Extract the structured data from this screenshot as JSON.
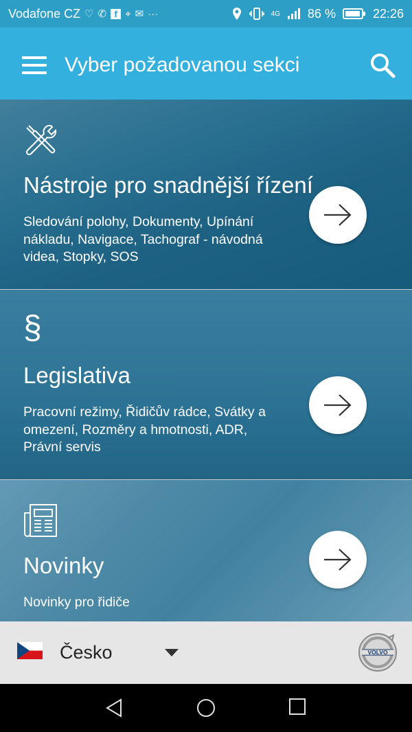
{
  "status_bar": {
    "carrier": "Vodafone CZ",
    "notification_icons": [
      "heart-rate-icon",
      "viber-icon",
      "facebook-icon",
      "maps-icon",
      "mail-icon",
      "more-icon"
    ],
    "more": "···",
    "battery_percent": "86 %",
    "time": "22:26",
    "network": "4G"
  },
  "app_bar": {
    "title": "Vyber požadovanou sekci"
  },
  "sections": [
    {
      "icon": "tools-icon",
      "title": "Nástroje pro snadnější řízení",
      "description": "Sledování polohy, Dokumenty, Upínání nákladu, Navigace, Tachograf - návodná videa, Stopky, SOS"
    },
    {
      "icon": "paragraph-icon",
      "icon_glyph": "§",
      "title": "Legislativa",
      "description": "Pracovní režimy, Řidičův rádce, Svátky a omezení, Rozměry a hmotnosti, ADR, Právní servis"
    },
    {
      "icon": "newspaper-icon",
      "title": "Novinky",
      "description": "Novinky pro řidiče"
    }
  ],
  "footer": {
    "country": "Česko",
    "flag": "czech-flag-icon",
    "logo_text": "VOLVO"
  },
  "colors": {
    "app_bar": "#33b0de",
    "status_bar": "#2d9fc7",
    "footer": "#e6e6e6"
  }
}
